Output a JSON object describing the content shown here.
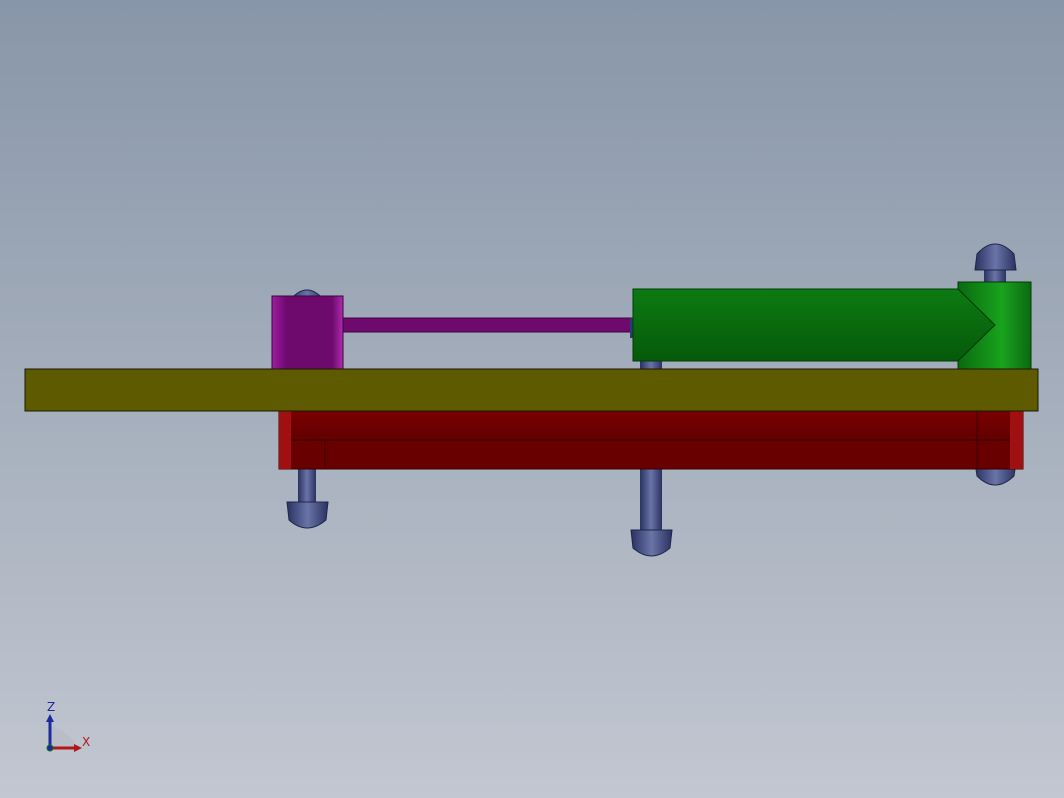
{
  "viewport": {
    "background_top": "#8896a9",
    "background_bottom": "#c2c7d1"
  },
  "parts": {
    "base_plate": {
      "color": "#5e5a00"
    },
    "red_frame": {
      "color": "#6e0000"
    },
    "magenta_block": {
      "color": "#7a0a78"
    },
    "magenta_rod": {
      "color": "#6e0a6e"
    },
    "green_cylinder": {
      "color": "#0a6e0a"
    },
    "bolts": {
      "color": "#3c4677"
    }
  },
  "triad": {
    "z_label": "Z",
    "x_label": "X",
    "z_color": "#1b2a9c",
    "x_color": "#b01818"
  }
}
